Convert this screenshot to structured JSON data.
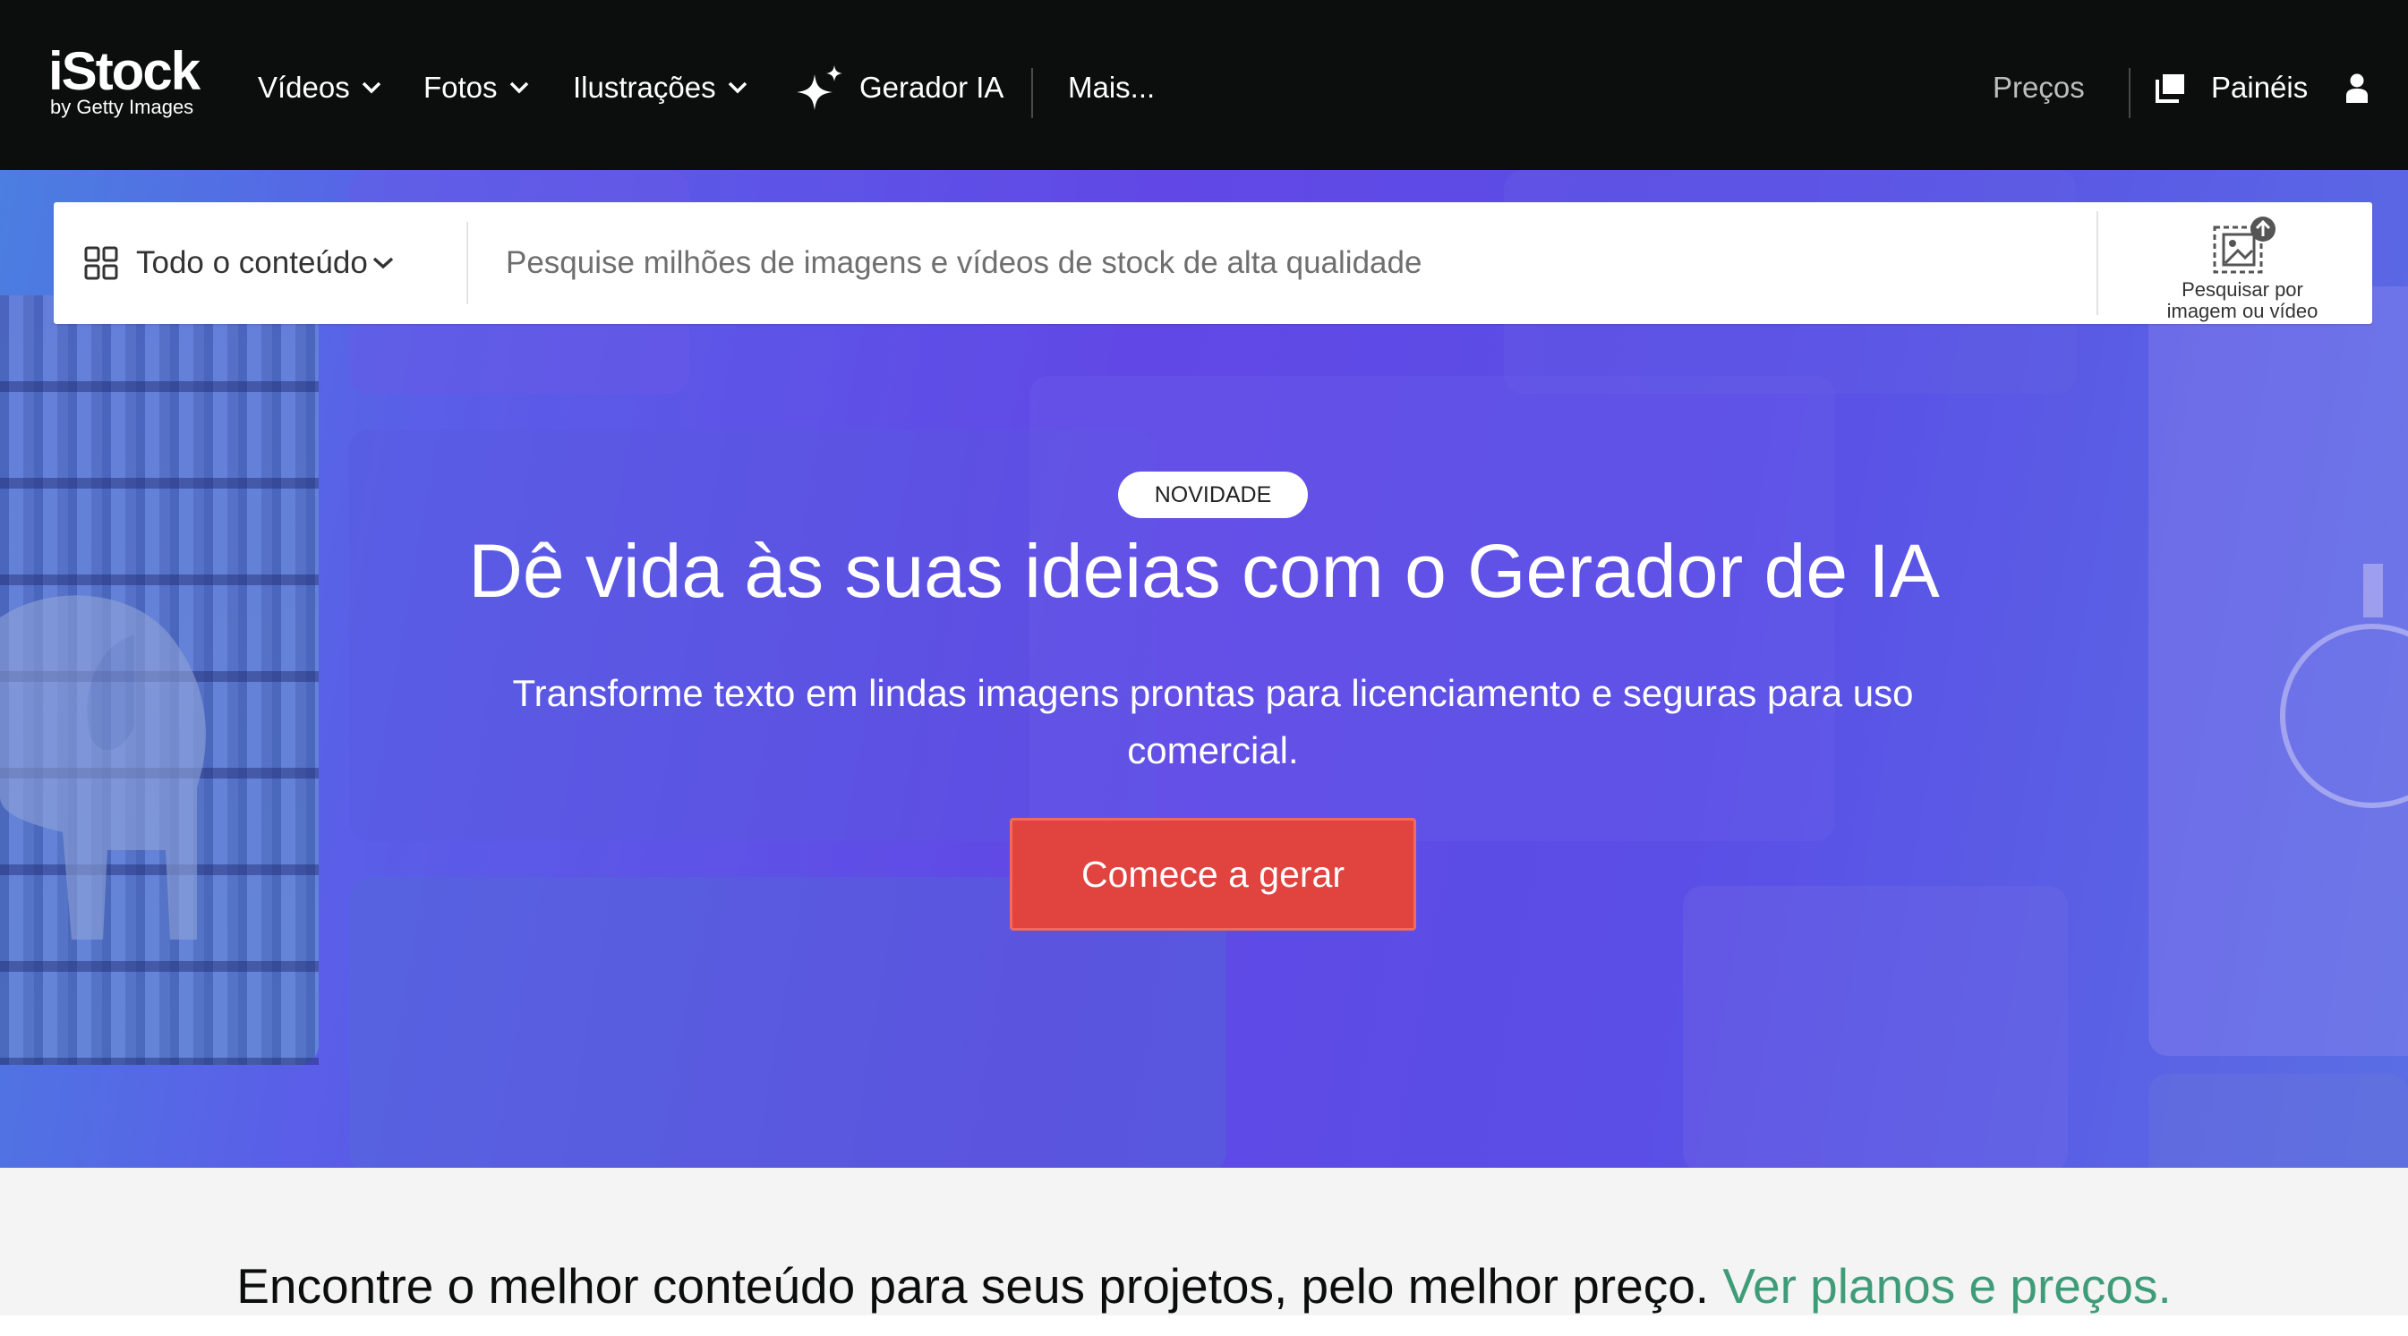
{
  "nav": {
    "logo_main": "iStock",
    "logo_sub": "by Getty Images",
    "items": [
      {
        "label": "Vídeos",
        "icon": "chevron-down-icon"
      },
      {
        "label": "Fotos",
        "icon": "chevron-down-icon"
      },
      {
        "label": "Ilustrações",
        "icon": "chevron-down-icon"
      },
      {
        "label": "Gerador IA",
        "icon": "sparkle-icon"
      },
      {
        "label": "Mais..."
      }
    ],
    "pricing_label": "Preços",
    "boards_label": "Painéis",
    "boards_icon": "boards-icon",
    "account_icon": "user-icon"
  },
  "search": {
    "filter_label": "Todo o conteúdo",
    "filter_icon": "grid-icon",
    "placeholder": "Pesquise milhões de imagens e vídeos de stock de alta qualidade",
    "value": "",
    "visual_search_label_line1": "Pesquisar por",
    "visual_search_label_line2": "imagem ou vídeo",
    "visual_search_icon": "image-upload-icon"
  },
  "hero": {
    "badge": "NOVIDADE",
    "title": "Dê vida às suas ideias com o Gerador de IA",
    "subtitle": "Transforme texto em lindas imagens prontas para licenciamento e seguras para uso comercial.",
    "cta": "Comece a gerar"
  },
  "promo": {
    "text": "Encontre o melhor conteúdo para seus projetos, pelo melhor preço.",
    "link": "Ver planos e preços."
  },
  "colors": {
    "nav_bg": "#0c0d0d",
    "cta_bg": "#e1433f",
    "link_green": "#3f9c78",
    "hero_purple": "#6148e6"
  }
}
